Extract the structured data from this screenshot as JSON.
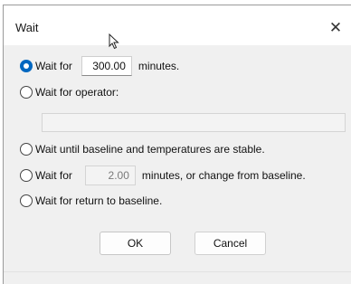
{
  "window": {
    "title": "Wait",
    "close_glyph": "✕"
  },
  "options": {
    "wait_for": {
      "label": "Wait for",
      "value": "300.00",
      "suffix": "minutes.",
      "selected": true
    },
    "wait_operator": {
      "label": "Wait for operator:",
      "value": ""
    },
    "wait_baseline_temp": {
      "label": "Wait until baseline and temperatures are stable."
    },
    "wait_or_change": {
      "label": "Wait for",
      "value": "2.00",
      "suffix": "minutes, or change from baseline."
    },
    "wait_return": {
      "label": "Wait for return to baseline."
    }
  },
  "buttons": {
    "ok": "OK",
    "cancel": "Cancel"
  },
  "colors": {
    "accent": "#0067c0",
    "dialog_bg": "#f0f0f0"
  }
}
